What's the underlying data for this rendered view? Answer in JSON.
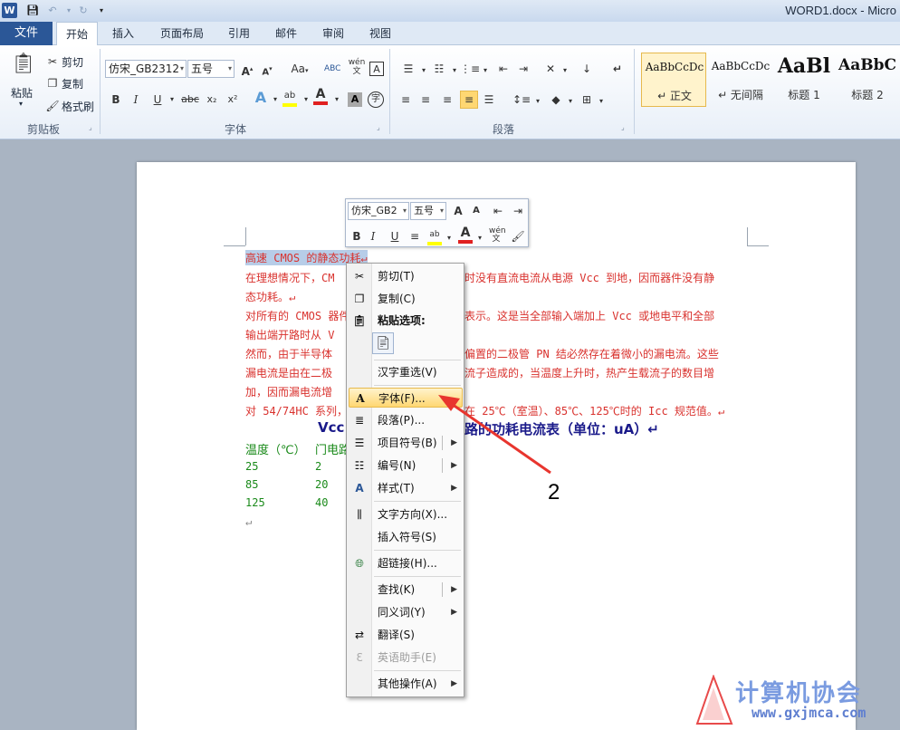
{
  "app": {
    "doc_title": "WORD1.docx - Micro",
    "logo": "W"
  },
  "tabs": {
    "file": "文件",
    "items": [
      "开始",
      "插入",
      "页面布局",
      "引用",
      "邮件",
      "审阅",
      "视图"
    ],
    "active": "开始"
  },
  "ribbon": {
    "clipboard": {
      "paste": "粘贴",
      "cut": "剪切",
      "copy": "复制",
      "format_painter": "格式刷",
      "label": "剪贴板"
    },
    "font": {
      "family": "仿宋_GB2312",
      "size": "五号",
      "label": "字体",
      "phonetic": "wén",
      "phonetic_char": "文",
      "bold": "B",
      "italic": "I",
      "underline": "U",
      "strike": "abc",
      "subscript": "x₂",
      "superscript": "x²",
      "grow": "A",
      "shrink": "A",
      "case": "Aa",
      "highlight": "ab",
      "color": "A",
      "char_shade": "A",
      "enclose": "字"
    },
    "paragraph": {
      "label": "段落"
    },
    "styles": [
      {
        "sample": "AaBbCcDc",
        "name": "↵ 正文"
      },
      {
        "sample": "AaBbCcDc",
        "name": "↵ 无间隔"
      },
      {
        "sample": "AaBl",
        "name": "标题 1"
      },
      {
        "sample": "AaBbC",
        "name": "标题 2"
      }
    ]
  },
  "mini_toolbar": {
    "font": "仿宋_GB2",
    "size": "五号",
    "bold": "B",
    "italic": "I",
    "underline": "U"
  },
  "document": {
    "line1": "高速 CMOS 的静态功耗↵",
    "line2": "在理想情况下，CM",
    "line2b": "时没有直流电流从电源 Vcc 到地，因而器件没有静",
    "line3": "态功耗。↵",
    "line4": "对所有的 CMOS 器件",
    "line4b": "表示。这是当全部输入端加上 Vcc 或地电平和全部",
    "line5": "输出端开路时从 V",
    "line6": "然而，由于半导体",
    "line6b": "偏置的二极管 PN 结必然存在着微小的漏电流。这些",
    "line7": "漏电流是由在二极",
    "line7b": "流子造成的，当温度上升时，热产生载流子的数目增",
    "line8": "加，因而漏电流增",
    "line9": "对 54/74HC 系列，",
    "line9b": "在 25℃（室温）、85℃、125℃时的 Icc 规范值。↵",
    "table_title_left": "Vcc",
    "table_title_right": "路的功耗电流表（单位：uA）↵",
    "header_col1": "温度（℃）",
    "header_col2": "门电路",
    "rows": [
      [
        "25",
        "2"
      ],
      [
        "85",
        "20"
      ],
      [
        "125",
        "40"
      ]
    ],
    "end_mark": "↵"
  },
  "context_menu": {
    "items": [
      {
        "label": "剪切(T)",
        "icon": "scissors-icon"
      },
      {
        "label": "复制(C)",
        "icon": "copy-icon"
      },
      {
        "label": "粘贴选项:",
        "icon": "paste-icon"
      },
      {
        "label": "汉字重选(V)",
        "icon": ""
      },
      {
        "label": "字体(F)...",
        "icon": "font-icon"
      },
      {
        "label": "段落(P)...",
        "icon": "paragraph-icon"
      },
      {
        "label": "项目符号(B)",
        "icon": "bullets-icon"
      },
      {
        "label": "编号(N)",
        "icon": "numbering-icon"
      },
      {
        "label": "样式(T)",
        "icon": "styles-icon"
      },
      {
        "label": "文字方向(X)...",
        "icon": "text-direction-icon"
      },
      {
        "label": "插入符号(S)",
        "icon": ""
      },
      {
        "label": "超链接(H)...",
        "icon": "hyperlink-icon"
      },
      {
        "label": "查找(K)",
        "icon": ""
      },
      {
        "label": "同义词(Y)",
        "icon": ""
      },
      {
        "label": "翻译(S)",
        "icon": "translate-icon"
      },
      {
        "label": "英语助手(E)",
        "icon": "english-assistant-icon"
      },
      {
        "label": "其他操作(A)",
        "icon": ""
      }
    ]
  },
  "annotation": {
    "number": "2"
  },
  "watermark": {
    "text": "计算机协会",
    "url": "www.gxjmca.com"
  },
  "colors": {
    "file_tab": "#2b5797",
    "doc_text": "#d9322e",
    "table_header": "#1a8a1a",
    "highlight": "#ffd772",
    "arrow": "#e8352e"
  }
}
